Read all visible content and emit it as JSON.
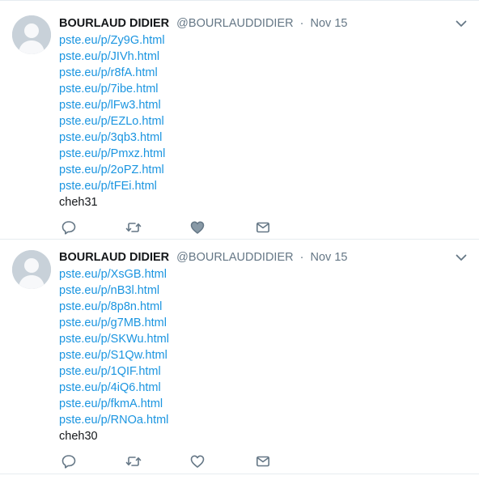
{
  "tweets": [
    {
      "fullname": "BOURLAUD DIDIER",
      "username": "@BOURLAUDDIDIER",
      "separator": "·",
      "time": "Nov 15",
      "links": [
        "pste.eu/p/Zy9G.html",
        "pste.eu/p/JIVh.html",
        "pste.eu/p/r8fA.html",
        "pste.eu/p/7ibe.html",
        "pste.eu/p/lFw3.html",
        "pste.eu/p/EZLo.html",
        "pste.eu/p/3qb3.html",
        "pste.eu/p/Pmxz.html",
        "pste.eu/p/2oPZ.html",
        "pste.eu/p/tFEi.html"
      ],
      "tag": "cheh31"
    },
    {
      "fullname": "BOURLAUD DIDIER",
      "username": "@BOURLAUDDIDIER",
      "separator": "·",
      "time": "Nov 15",
      "links": [
        "pste.eu/p/XsGB.html",
        "pste.eu/p/nB3l.html",
        "pste.eu/p/8p8n.html",
        "pste.eu/p/g7MB.html",
        "pste.eu/p/SKWu.html",
        "pste.eu/p/S1Qw.html",
        "pste.eu/p/1QIF.html",
        "pste.eu/p/4iQ6.html",
        "pste.eu/p/fkmA.html",
        "pste.eu/p/RNOa.html"
      ],
      "tag": "cheh30"
    }
  ],
  "icons": {
    "menu": "chevron-down-icon",
    "reply": "reply-icon",
    "retweet": "retweet-icon",
    "like": "heart-icon",
    "dm": "direct-message-icon",
    "avatar": "default-avatar"
  },
  "colors": {
    "link": "#1b95e0",
    "name": "#14171a",
    "meta": "#657786",
    "icon": "#657786",
    "border": "#e6ecf0",
    "avatar_bg": "#c8d1d9"
  }
}
